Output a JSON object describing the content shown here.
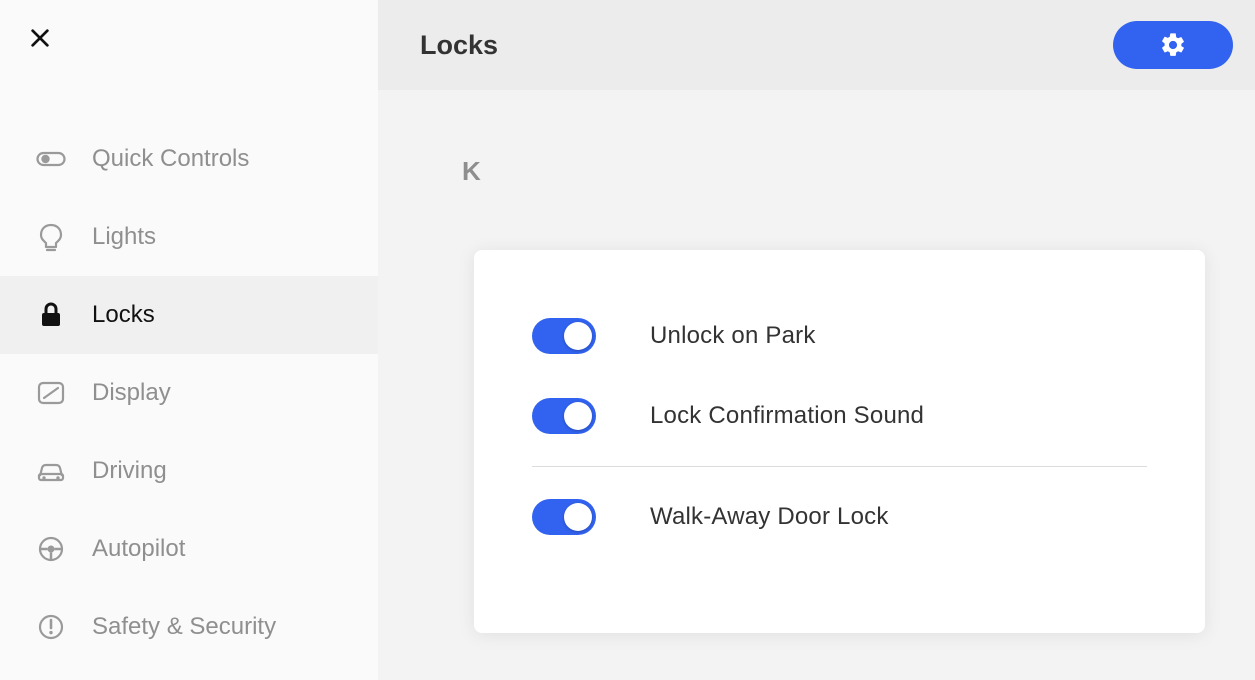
{
  "sidebar": {
    "items": [
      {
        "label": "Quick Controls",
        "icon": "toggle-icon",
        "active": false
      },
      {
        "label": "Lights",
        "icon": "bulb-icon",
        "active": false
      },
      {
        "label": "Locks",
        "icon": "lock-icon",
        "active": true
      },
      {
        "label": "Display",
        "icon": "display-icon",
        "active": false
      },
      {
        "label": "Driving",
        "icon": "car-icon",
        "active": false
      },
      {
        "label": "Autopilot",
        "icon": "wheel-icon",
        "active": false
      },
      {
        "label": "Safety & Security",
        "icon": "alert-icon",
        "active": false
      }
    ]
  },
  "header": {
    "title": "Locks"
  },
  "content": {
    "background_label": "K",
    "toggles": [
      {
        "label": "Unlock on Park",
        "value": true
      },
      {
        "label": "Lock Confirmation Sound",
        "value": true
      },
      {
        "label": "Walk-Away Door Lock",
        "value": true
      }
    ]
  },
  "colors": {
    "accent": "#3263f0"
  }
}
